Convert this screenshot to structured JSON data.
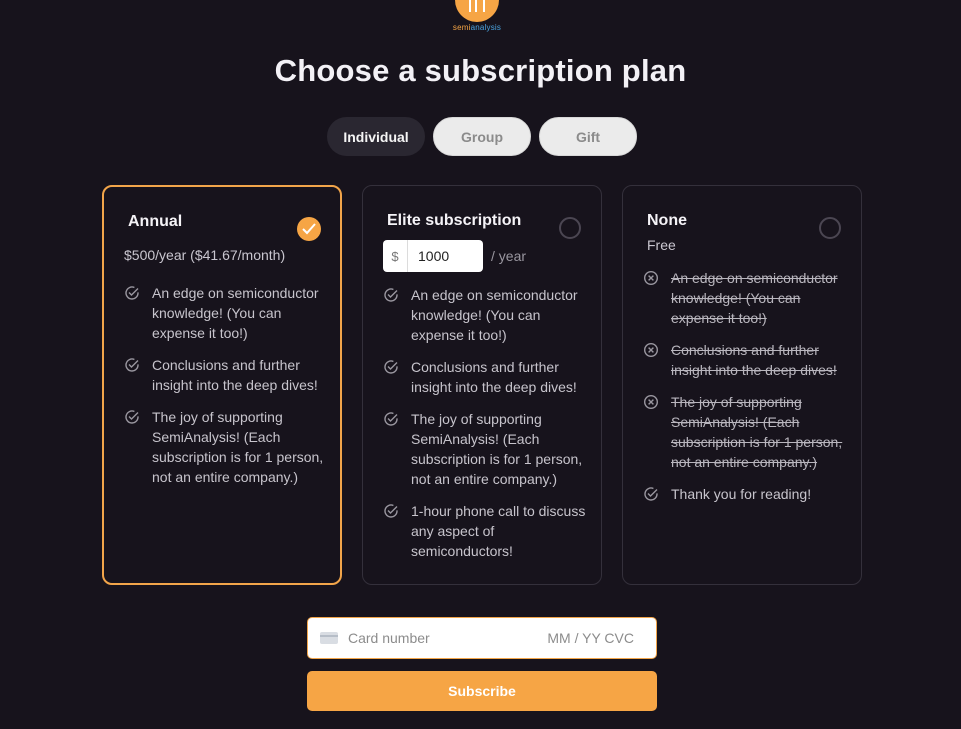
{
  "logo": {
    "text_a": "semi",
    "text_b": "analysis"
  },
  "title": "Choose a subscription plan",
  "tabs": [
    {
      "label": "Individual",
      "active": true
    },
    {
      "label": "Group",
      "active": false
    },
    {
      "label": "Gift",
      "active": false
    }
  ],
  "plans": {
    "annual": {
      "title": "Annual",
      "price": "$500/year ($41.67/month)",
      "selected": true,
      "features": [
        "An edge on semiconductor knowledge! (You can expense it too!)",
        "Conclusions and further insight into the deep dives!",
        "The joy of supporting SemiAnalysis! (Each subscription is for 1 person, not an entire company.)"
      ]
    },
    "elite": {
      "title": "Elite subscription",
      "currency": "$",
      "amount": "1000",
      "per": "/ year",
      "selected": false,
      "features": [
        "An edge on semiconductor knowledge! (You can expense it too!)",
        "Conclusions and further insight into the deep dives!",
        "The joy of supporting SemiAnalysis! (Each subscription is for 1 person, not an entire company.)",
        "1-hour phone call to discuss any aspect of semiconductors!"
      ]
    },
    "none": {
      "title": "None",
      "price": "Free",
      "selected": false,
      "features": [
        "An edge on semiconductor knowledge! (You can expense it too!)",
        "Conclusions and further insight into the deep dives!",
        "The joy of supporting SemiAnalysis! (Each subscription is for 1 person, not an entire company.)",
        "Thank you for reading!"
      ]
    }
  },
  "payment": {
    "card_placeholder": "Card number",
    "expiry_cvc_placeholder": "MM / YY  CVC",
    "subscribe_label": "Subscribe"
  },
  "colors": {
    "accent": "#f6a545",
    "background": "#17131c"
  }
}
